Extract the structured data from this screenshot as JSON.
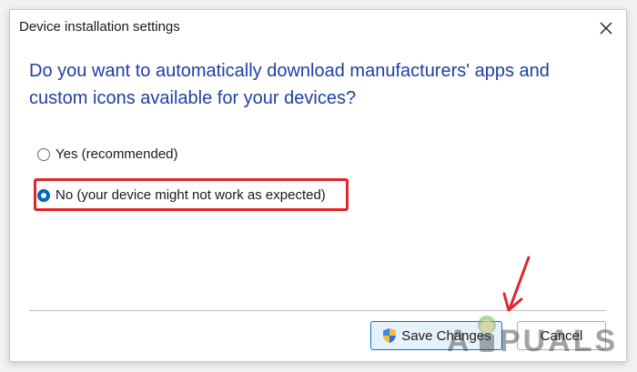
{
  "dialog": {
    "title": "Device installation settings",
    "close_icon": "close-icon",
    "question": "Do you want to automatically download manufacturers' apps and custom icons available for your devices?",
    "options": [
      {
        "label": "Yes (recommended)",
        "selected": false
      },
      {
        "label": "No (your device might not work as expected)",
        "selected": true
      }
    ],
    "buttons": {
      "save_label": "Save Changes",
      "save_icon": "uac-shield-icon",
      "cancel_label": "Cancel"
    }
  },
  "annotation": {
    "highlight_color": "#e0252b",
    "arrow_color": "#e0252b"
  },
  "watermark": {
    "text": "APPUALS"
  },
  "colors": {
    "question_text": "#1f3fa3",
    "accent": "#0067c0",
    "save_button_bg": "#e5f1fb",
    "save_button_border": "#0078d4"
  }
}
